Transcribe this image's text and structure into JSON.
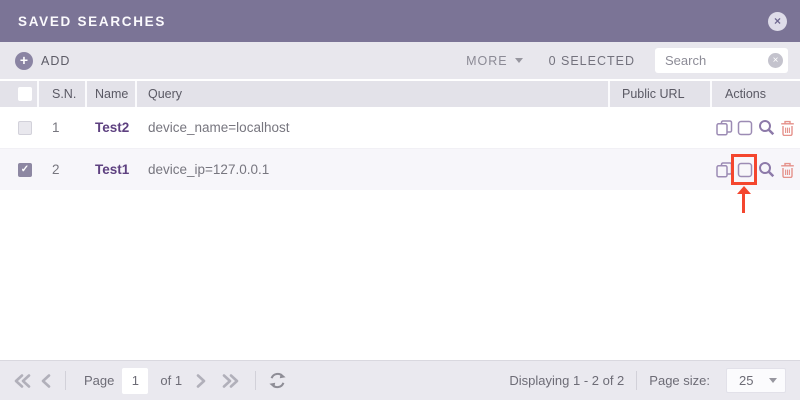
{
  "header": {
    "title": "SAVED SEARCHES"
  },
  "toolbar": {
    "add_label": "ADD",
    "more_label": "MORE",
    "selected_label": "0 SELECTED",
    "search_placeholder": "Search"
  },
  "table": {
    "columns": {
      "sn": "S.N.",
      "name": "Name",
      "query": "Query",
      "public_url": "Public URL",
      "actions": "Actions"
    },
    "rows": [
      {
        "sn": "1",
        "name": "Test2",
        "query": "device_name=localhost",
        "public_url": ""
      },
      {
        "sn": "2",
        "name": "Test1",
        "query": "device_ip=127.0.0.1",
        "public_url": ""
      }
    ]
  },
  "footer": {
    "page_label": "Page",
    "page_value": "1",
    "of_label": "of 1",
    "displaying_label": "Displaying 1 - 2 of 2",
    "page_size_label": "Page size:",
    "page_size_value": "25"
  },
  "icons": {
    "plus": "+",
    "close": "×",
    "clear": "×",
    "checkmark": "✓"
  },
  "colors": {
    "titlebar": "#7b7496",
    "accent_purple": "#9c8bb4",
    "danger_red": "#e5928b",
    "annotation_red": "#f4462e"
  }
}
